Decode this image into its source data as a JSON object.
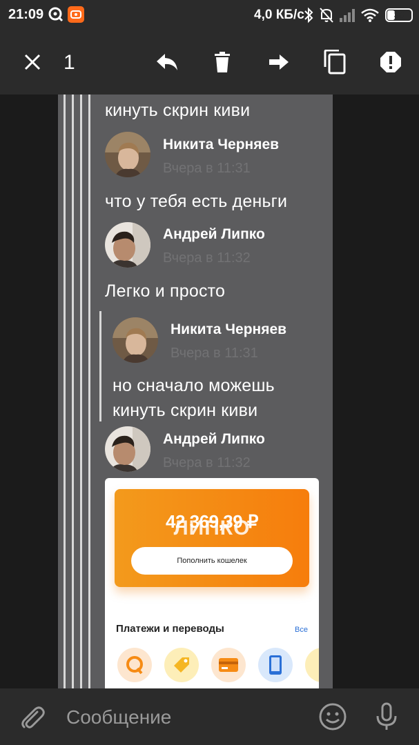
{
  "status_bar": {
    "time": "21:09",
    "speed": "4,0 КБ/с",
    "battery": "30",
    "battery_level": 0.3
  },
  "action_bar": {
    "selected_count": "1",
    "icons": [
      "close-icon",
      "reply-icon",
      "delete-icon",
      "forward-icon",
      "copy-icon",
      "report-icon"
    ]
  },
  "messages": [
    {
      "text_top": "кинуть скрин киви"
    },
    {
      "author": "Никита Черняев",
      "time": "Вчера в 11:31",
      "text": "что у тебя есть деньги"
    },
    {
      "author": "Андрей Липко",
      "time": "Вчера в 11:32",
      "text": "Легко и просто"
    },
    {
      "author": "Никита Черняев",
      "time": "Вчера в 11:31",
      "text_line1": "но сначало можешь",
      "text_line2": "кинуть скрин киви"
    },
    {
      "author": "Андрей Липко",
      "time": "Вчера в 11:32"
    }
  ],
  "qiwi_screenshot": {
    "balance": "42 369,39 ₽",
    "overlay_text": "ЛИПКО",
    "topup_button": "Пополнить кошелек",
    "section_title": "Платежи и переводы",
    "all_link": "Все"
  },
  "input_bar": {
    "placeholder": "Сообщение"
  },
  "colors": {
    "background": "#1b1b1b",
    "bar": "#2b2b2b",
    "panel": "#5c5c5e",
    "time_text": "#727274",
    "qiwi_orange": "#f68b14"
  }
}
